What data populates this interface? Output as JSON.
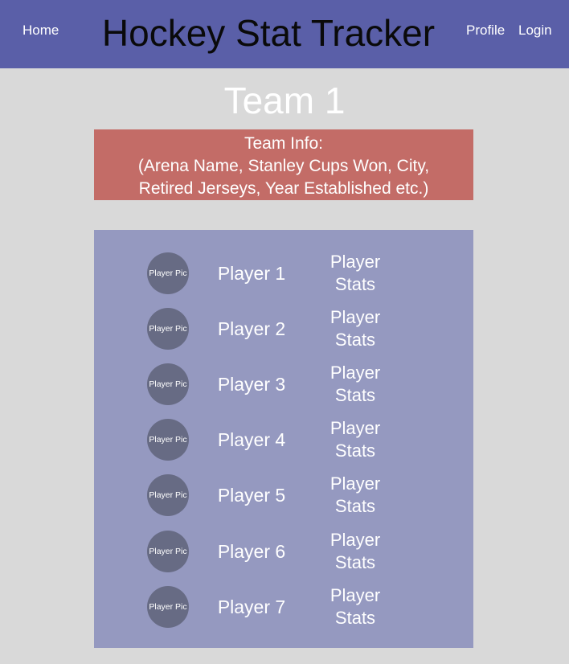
{
  "nav": {
    "home": "Home",
    "title": "Hockey Stat Tracker",
    "profile": "Profile",
    "login": "Login"
  },
  "team": {
    "name": "Team 1",
    "info_lines": [
      "Team Info:",
      "(Arena Name, Stanley Cups Won, City,",
      "Retired Jerseys, Year Established etc.)"
    ]
  },
  "players": [
    {
      "pic": "Player Pic",
      "name": "Player 1",
      "stats_line1": "Player",
      "stats_line2": "Stats"
    },
    {
      "pic": "Player Pic",
      "name": "Player 2",
      "stats_line1": "Player",
      "stats_line2": "Stats"
    },
    {
      "pic": "Player Pic",
      "name": "Player 3",
      "stats_line1": "Player",
      "stats_line2": "Stats"
    },
    {
      "pic": "Player Pic",
      "name": "Player 4",
      "stats_line1": "Player",
      "stats_line2": "Stats"
    },
    {
      "pic": "Player Pic",
      "name": "Player 5",
      "stats_line1": "Player",
      "stats_line2": "Stats"
    },
    {
      "pic": "Player Pic",
      "name": "Player 6",
      "stats_line1": "Player",
      "stats_line2": "Stats"
    },
    {
      "pic": "Player Pic",
      "name": "Player 7",
      "stats_line1": "Player",
      "stats_line2": "Stats"
    }
  ],
  "colors": {
    "navbar": "#5a5fa8",
    "background": "#d9d9d9",
    "team_info": "#c36c67",
    "roster": "#9599c0",
    "player_pic": "#676b84"
  }
}
